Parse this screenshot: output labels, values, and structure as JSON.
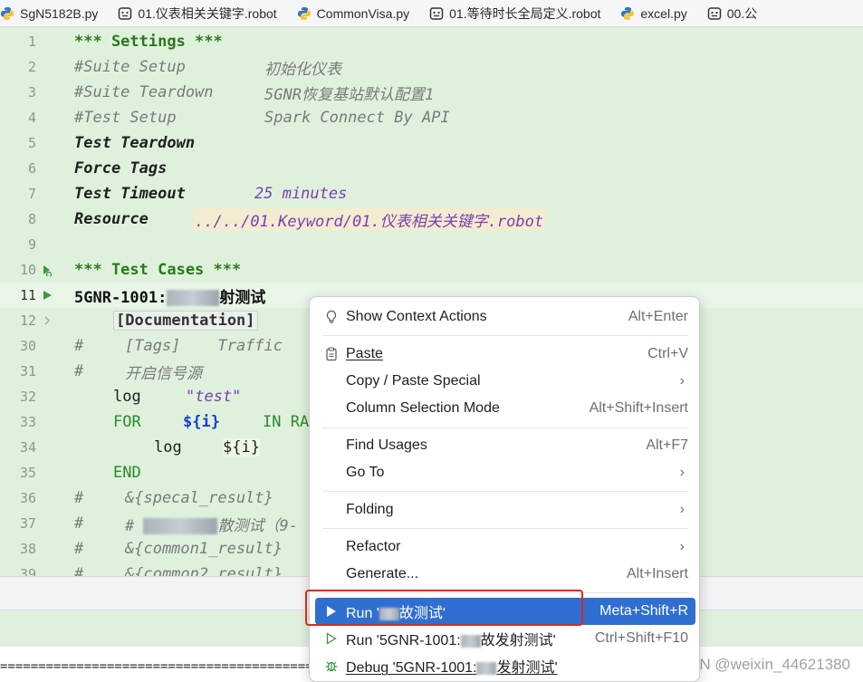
{
  "tabs": [
    {
      "label": "SgN5182B.py",
      "icon": "python-icon"
    },
    {
      "label": "01.仪表相关关键字.robot",
      "icon": "robot-icon"
    },
    {
      "label": "CommonVisa.py",
      "icon": "python-icon"
    },
    {
      "label": "01.等待时长全局定义.robot",
      "icon": "robot-icon"
    },
    {
      "label": "excel.py",
      "icon": "python-icon"
    },
    {
      "label": "00.公",
      "icon": "robot-icon"
    }
  ],
  "editor": {
    "lines": [
      {
        "num": "1",
        "text": "*** Settings ***"
      },
      {
        "num": "2",
        "setting": "#Suite Setup",
        "value": "初始化仪表"
      },
      {
        "num": "3",
        "setting": "#Suite Teardown",
        "value": "5GNR恢复基站默认配置1"
      },
      {
        "num": "4",
        "setting": "#Test Setup",
        "value": "Spark Connect By API"
      },
      {
        "num": "5",
        "setting": "Test Teardown"
      },
      {
        "num": "6",
        "setting": "Force Tags"
      },
      {
        "num": "7",
        "setting": "Test Timeout",
        "value": "25 minutes"
      },
      {
        "num": "8",
        "setting": "Resource",
        "value": "../../01.Keyword/01.仪表相关关键字.robot"
      },
      {
        "num": "9",
        "text": ""
      },
      {
        "num": "10",
        "text": "*** Test Cases ***"
      },
      {
        "num": "11",
        "prefix": "5GNR-1001:",
        "suffix": "射测试"
      },
      {
        "num": "12",
        "text": "[Documentation]"
      },
      {
        "num": "30",
        "hash": "#",
        "text": "[Tags]    Traffic"
      },
      {
        "num": "31",
        "hash": "#",
        "text": "开启信号源"
      },
      {
        "num": "32",
        "kw": "log",
        "value": "\"test\""
      },
      {
        "num": "33",
        "kw": "FOR",
        "var": "${i}",
        "rest": "IN RA"
      },
      {
        "num": "34",
        "kw": "log",
        "var": "${i}"
      },
      {
        "num": "35",
        "kw": "END"
      },
      {
        "num": "36",
        "hash": "#",
        "text": "&{specal_result}"
      },
      {
        "num": "37",
        "hash": "#",
        "text": "# ",
        "suffix": "散测试（9-"
      },
      {
        "num": "38",
        "hash": "#",
        "text": "&{common1_result}"
      },
      {
        "num": "39",
        "hash": "#",
        "text": "&{common2_result}"
      }
    ]
  },
  "context_menu": {
    "show_context_actions": {
      "label": "Show Context Actions",
      "shortcut": "Alt+Enter"
    },
    "paste": {
      "label": "Paste",
      "shortcut": "Ctrl+V"
    },
    "copy_paste_special": {
      "label": "Copy / Paste Special"
    },
    "column_selection": {
      "label": "Column Selection Mode",
      "shortcut": "Alt+Shift+Insert"
    },
    "find_usages": {
      "label": "Find Usages",
      "shortcut": "Alt+F7"
    },
    "go_to": {
      "label": "Go To"
    },
    "folding": {
      "label": "Folding"
    },
    "refactor": {
      "label": "Refactor"
    },
    "generate": {
      "label": "Generate...",
      "shortcut": "Alt+Insert"
    },
    "run_test": {
      "label_prefix": "Run '",
      "label_suffix": "故测试'",
      "shortcut": "Meta+Shift+R"
    },
    "run_case": {
      "label_prefix": "Run '5GNR-1001:",
      "label_suffix": "故发射测试'",
      "shortcut": "Ctrl+Shift+F10"
    },
    "debug_case": {
      "label_prefix": "Debug '5GNR-1001:",
      "label_suffix": "发射测试'"
    }
  },
  "console": {
    "text": "================================================"
  },
  "watermark": "CSDN @weixin_44621380",
  "colors": {
    "editor_bg": "#dff1dd",
    "selection": "#2f6fd1",
    "highlight_border": "#e2261d",
    "section": "#2a7a1a"
  }
}
